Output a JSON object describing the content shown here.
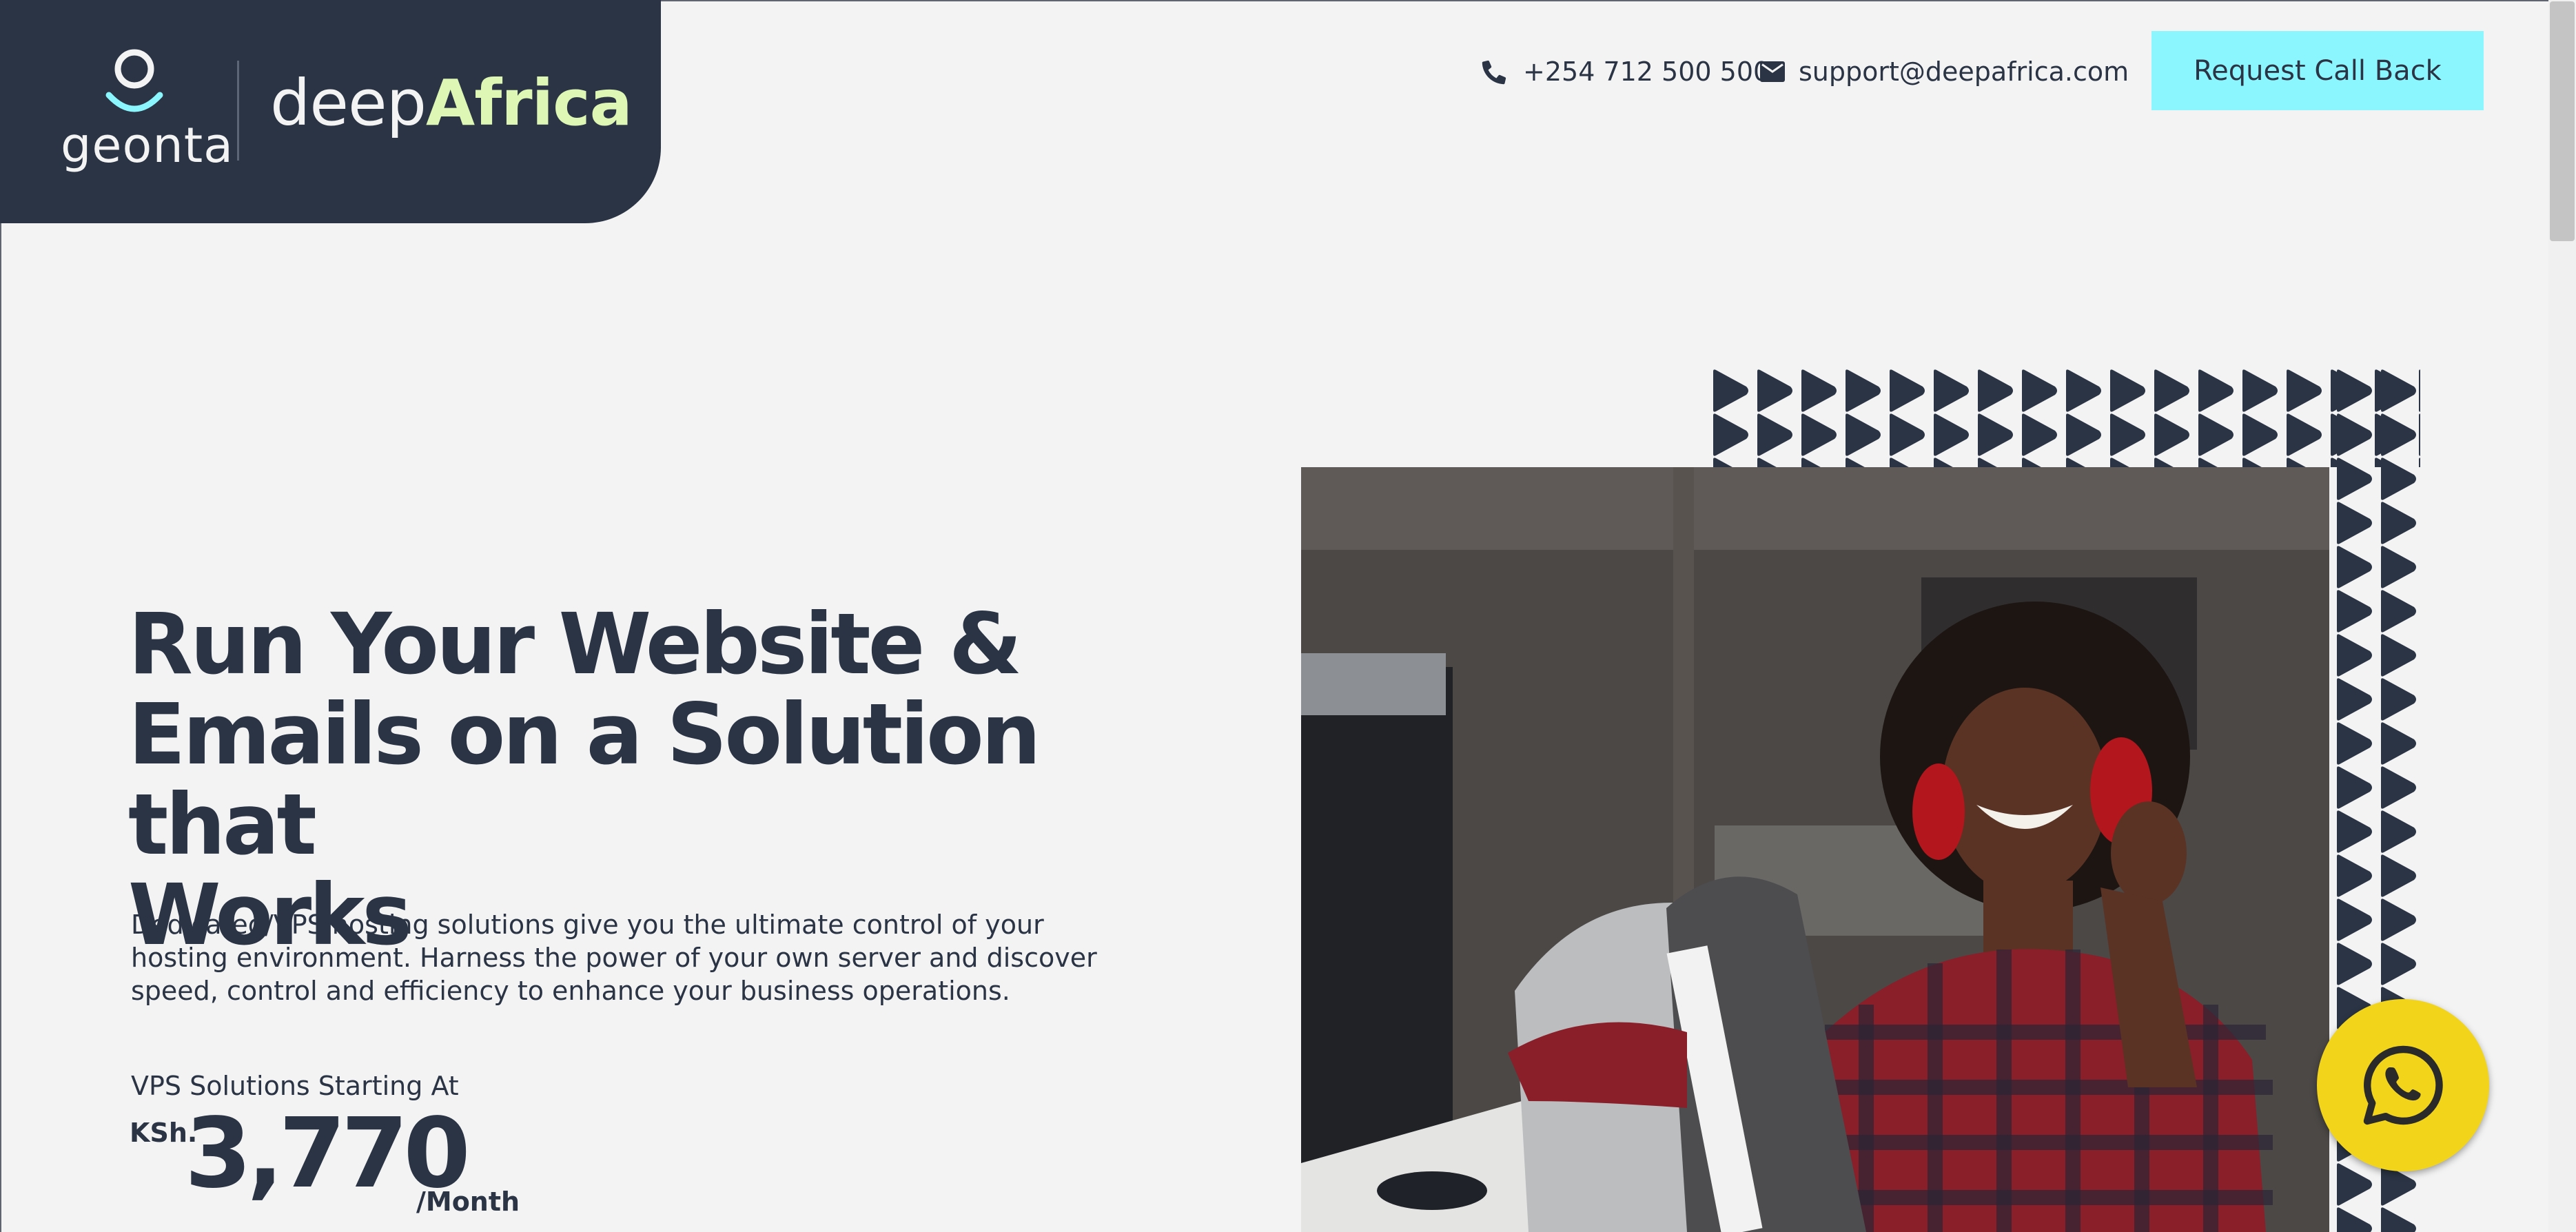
{
  "header": {
    "logo": {
      "geonta": "geonta",
      "brand_prefix": "deep",
      "brand_suffix": "Africa"
    },
    "phone": "+254 712 500 500",
    "email": "support@deepafrica.com",
    "cta_label": "Request Call Back"
  },
  "hero": {
    "title_line1": "Run Your Website &",
    "title_line2": "Emails on a Solution that",
    "title_line3": "Works",
    "description": "Dedicated/VPS hosting solutions give you the ultimate control of your hosting environment. Harness the power of your own server and discover speed, control and efficiency to enhance your business operations.",
    "price_label": "VPS Solutions Starting At",
    "currency": "KSh.",
    "price": "3,770",
    "period": "/Month"
  },
  "icons": {
    "phone": "phone-icon",
    "email": "mail-icon",
    "whatsapp": "whatsapp-icon",
    "logo": "geonta-logo-icon"
  },
  "colors": {
    "navy": "#2a3444",
    "cta": "#8cf6ff",
    "brand_highlight": "#dff7b4",
    "whatsapp": "#f2d41a",
    "background": "#f3f3f3"
  }
}
